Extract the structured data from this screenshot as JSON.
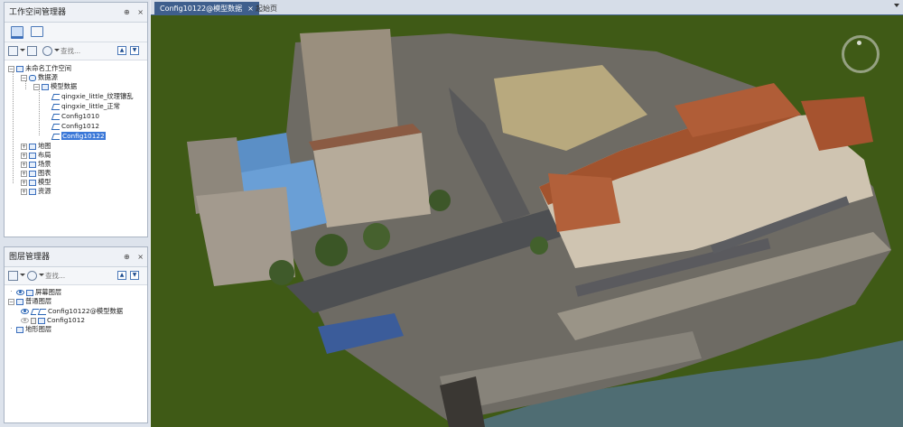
{
  "workspace_panel": {
    "title": "工作空间管理器",
    "pin": "⊕",
    "close": "×",
    "search_placeholder": "查找...",
    "tree": {
      "root": "未命名工作空间",
      "datasources": "数据源",
      "model_data": "模型数据",
      "children": [
        "qingxie_little_纹理镶乱",
        "qingxie_little_正常",
        "Config1010",
        "Config1012",
        "Config10122"
      ],
      "selected": "Config10122",
      "map": "地图",
      "layout": "布局",
      "scene": "场景",
      "symbol": "图表",
      "model": "模型",
      "resources": "资源"
    }
  },
  "layer_panel": {
    "title": "图层管理器",
    "pin": "⊕",
    "close": "×",
    "search_placeholder": "查找...",
    "tree": {
      "screen_layer": "屏幕图层",
      "normal_layer": "普通图层",
      "layer1": "Config10122@模型数据",
      "layer2": "Config1012",
      "terrain_layer": "地形图层"
    }
  },
  "tabs": {
    "active": "Config10122@模型数据",
    "inactive": "起始页",
    "close": "×"
  },
  "colors": {
    "accent": "#3f5f8d",
    "selection": "#3b78d8",
    "scene_background": "#3f5a16"
  }
}
